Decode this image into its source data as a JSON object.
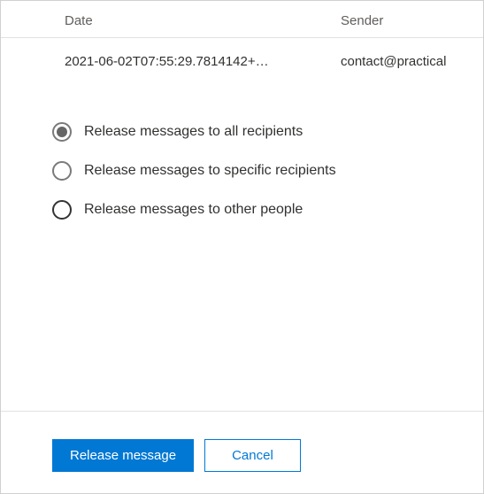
{
  "table": {
    "headers": {
      "date": "Date",
      "sender": "Sender"
    },
    "row": {
      "date": "2021-06-02T07:55:29.7814142+…",
      "sender": "contact@practical"
    }
  },
  "options": {
    "opt1": "Release messages to all recipients",
    "opt2": "Release messages to specific recipients",
    "opt3": "Release messages to other people",
    "selected": "opt1"
  },
  "buttons": {
    "primary": "Release message",
    "secondary": "Cancel"
  }
}
